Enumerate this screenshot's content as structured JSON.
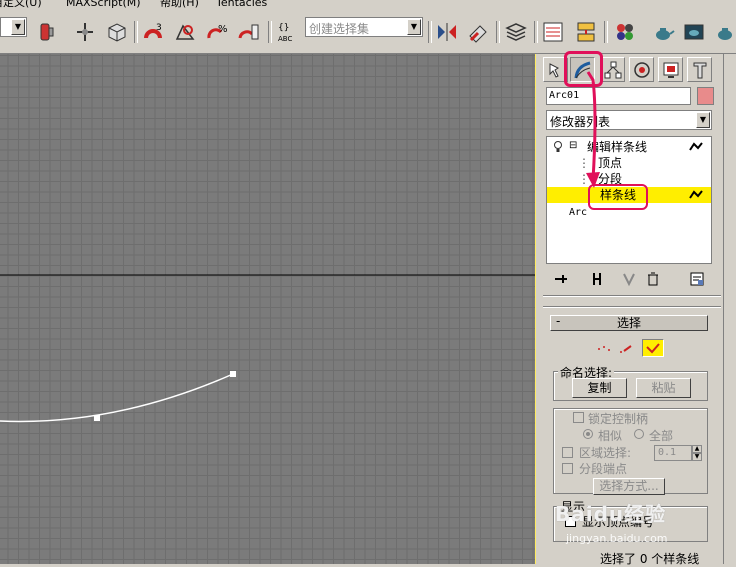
{
  "menubar": {
    "items": [
      "自定义(U)",
      "MAXScript(M)",
      "帮助(H)",
      "Tentacles"
    ]
  },
  "toolbar": {
    "selection_set_placeholder": "创建选择集",
    "icons": [
      "select-filter",
      "render-setup",
      "snap-toggle",
      "angle-snap",
      "percent-snap",
      "spinner-snap",
      "edit-named-selection",
      "mirror",
      "align",
      "layer-manager",
      "curve-editor",
      "schematic-view",
      "material-editor",
      "render-scene",
      "quick-render",
      "render-teapot"
    ]
  },
  "command_panel": {
    "tabs": [
      "create",
      "modify",
      "hierarchy",
      "motion",
      "display",
      "utilities"
    ],
    "active_tab": "modify",
    "object_name": "Arc01",
    "object_color": "#e88b8b",
    "modifier_list_label": "修改器列表",
    "stack": {
      "modifier": "编辑样条线",
      "sub_vertex": "顶点",
      "sub_segment": "分段",
      "sub_spline": "样条线",
      "base_object": "Arc"
    }
  },
  "selection_rollout": {
    "title": "选择",
    "collapse_symbol": "-",
    "named_selection_label": "命名选择:",
    "copy_label": "复制",
    "paste_label": "粘贴",
    "lock_handles_label": "锁定控制柄",
    "similar_label": "相似",
    "all_label": "全部",
    "area_select_label": "区域选择:",
    "area_select_value": "0.1",
    "segment_end_label": "分段端点",
    "select_by_label": "选择方式...",
    "display_label": "显示",
    "show_vertex_numbers_label": "显示顶点编号",
    "status": "选择了 0 个样条线"
  },
  "watermark": {
    "text": "Baidu经验",
    "url": "jingyan.baidu.com"
  },
  "colors": {
    "highlight": "#e0105a",
    "selection_yellow": "#ffee00",
    "viewport_bg": "#7b7b7b"
  }
}
